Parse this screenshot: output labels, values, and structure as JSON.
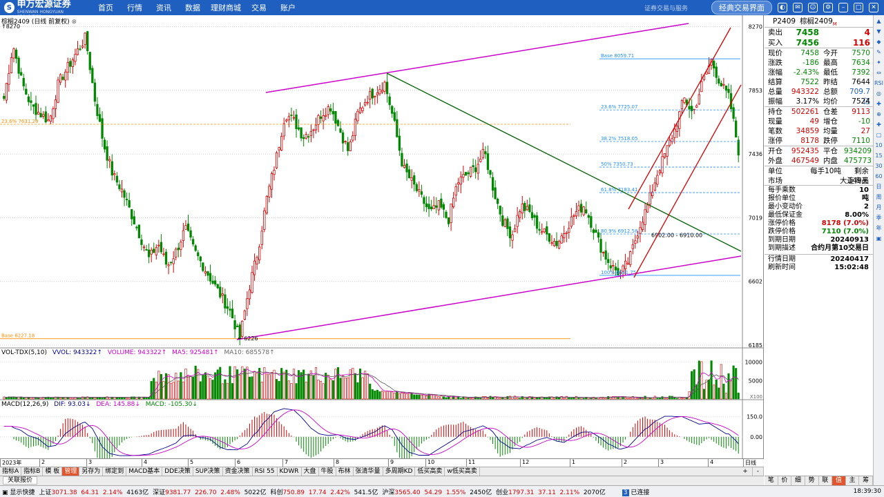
{
  "app": {
    "logo_name": "申万宏源证券",
    "logo_sub": "SHENWAN HONGYUAN SECURITIES",
    "menu": [
      "首页",
      "行情",
      "资讯",
      "数据",
      "理财商城",
      "交易",
      "账户"
    ],
    "slogan": "证券交易与服务",
    "classic_button": "经典交易界面"
  },
  "chart": {
    "symbol_title": "棕榈2409 (日线 前复权)",
    "top_label": "↑8270",
    "low_label": "← 6226",
    "fib_labels": {
      "base_top": "Base 8059.71",
      "f236": "23.6% 7725.07",
      "f382": "38.2% 7518.05",
      "f50": "50% 7350.73",
      "f618": "61.8% 7183.41",
      "f809": "80.9% 6912.58",
      "f100": "100% 6641.75",
      "left_f236": "23.6% 7631.29",
      "base_bottom": "Base 6227.18",
      "range_note": "6902.00 - 6910.00"
    },
    "vol_title": [
      "VOL-TDX(5,10)",
      "VVOL: 943322↑",
      "VOLUME: 943322↑",
      "MA5: 925481↑",
      "MA10: 685578↑"
    ],
    "macd_title": [
      "MACD(12,26,9)",
      "DIF: 93.03↓",
      "DEA: 145.88↓",
      "MACD: -105.30↓"
    ],
    "vol_axis": [
      "10000",
      "5000",
      "X100"
    ],
    "macd_axis": [
      "150.0",
      "0.00"
    ],
    "x_labels": [
      "2023年",
      "2",
      "3",
      "4",
      "5",
      "6",
      "7",
      "8",
      "9",
      "10",
      "11",
      "12",
      "1",
      "2",
      "3",
      "4"
    ],
    "period_label": "日线",
    "colors": {
      "up": "#d40000",
      "down": "#008800",
      "channel_magenta": "#cc00cc",
      "trend_green": "#006400",
      "channel_red": "#d40000",
      "fib_blue": "#1e90ff",
      "fib_orange": "#ff8c00"
    }
  },
  "chart_data": {
    "type": "candlestick",
    "symbol": "棕榈2409",
    "period": "日线",
    "yaxis_labels": [
      8270,
      7853,
      7436,
      7019,
      6602,
      6185
    ],
    "ylim": [
      6185,
      8300
    ],
    "price_range_low": 6226,
    "price_range_high": 8270,
    "last_close": 7458,
    "fib_levels": [
      8059.71,
      7725.07,
      7518.05,
      7350.73,
      7183.41,
      6912.58,
      6641.75
    ],
    "volume_ylim": [
      0,
      12000
    ],
    "macd_ylim": [
      -150,
      220
    ],
    "close_path": [
      7800,
      8150,
      7900,
      7750,
      7700,
      7650,
      7900,
      8000,
      8100,
      8200,
      7800,
      7500,
      7300,
      7200,
      7050,
      6900,
      6750,
      6850,
      6700,
      6800,
      6950,
      6800,
      6700,
      6600,
      6500,
      6400,
      6226,
      6550,
      6800,
      7150,
      7400,
      7700,
      7650,
      7550,
      7600,
      7700,
      7750,
      7600,
      7450,
      7700,
      7800,
      7850,
      7900,
      7650,
      7350,
      7250,
      7150,
      7050,
      7100,
      7000,
      7250,
      7300,
      7350,
      7450,
      7200,
      7000,
      6900,
      7100,
      7050,
      6950,
      6900,
      6850,
      6950,
      7050,
      7100,
      6950,
      6800,
      6700,
      6650,
      6750,
      6950,
      7100,
      7300,
      7450,
      7600,
      7800,
      7700,
      7900,
      8050,
      7900,
      7800,
      7458
    ]
  },
  "panel": {
    "code": "P2409",
    "name": "棕榈2409",
    "mark": "M",
    "sell": {
      "label": "卖出",
      "price": "7458",
      "vol": "4"
    },
    "buy": {
      "label": "买入",
      "price": "7456",
      "vol": "116"
    },
    "rows1": [
      {
        "l1": "现价",
        "v1": "7458",
        "c1": "grn",
        "l2": "今开",
        "v2": "7570",
        "c2": "grn"
      },
      {
        "l1": "涨跌",
        "v1": "-186",
        "c1": "grn",
        "l2": "最高",
        "v2": "7634",
        "c2": "grn"
      },
      {
        "l1": "涨幅",
        "v1": "-2.43%",
        "c1": "grn",
        "l2": "最低",
        "v2": "7392",
        "c2": "grn"
      },
      {
        "l1": "结算",
        "v1": "7522",
        "c1": "grn",
        "l2": "昨结",
        "v2": "7644",
        "c2": ""
      },
      {
        "l1": "总量",
        "v1": "943322",
        "c1": "red",
        "l2": "总额",
        "v2": "709.7亿",
        "c2": "blu"
      },
      {
        "l1": "振幅",
        "v1": "3.17%",
        "c1": "",
        "l2": "均价",
        "v2": "7524",
        "c2": ""
      }
    ],
    "rows2": [
      {
        "l1": "持仓",
        "v1": "502261",
        "c1": "red",
        "l2": "仓差",
        "v2": "9113",
        "c2": "red"
      },
      {
        "l1": "现量",
        "v1": "49",
        "c1": "red",
        "l2": "增仓",
        "v2": "-10",
        "c2": "grn"
      },
      {
        "l1": "笔数",
        "v1": "34859",
        "c1": "red",
        "l2": "均量",
        "v2": "27",
        "c2": "red"
      },
      {
        "l1": "涨停",
        "v1": "8178",
        "c1": "red",
        "l2": "跌停",
        "v2": "7110",
        "c2": "grn"
      }
    ],
    "rows3": [
      {
        "l1": "开仓",
        "v1": "952435",
        "c1": "red",
        "l2": "平仓",
        "v2": "934209",
        "c2": "grn"
      },
      {
        "l1": "外盘",
        "v1": "467549",
        "c1": "red",
        "l2": "内盘",
        "v2": "475773",
        "c2": "grn"
      }
    ],
    "unit_row": {
      "l1": "单位",
      "v1": "每手10吨",
      "l2": "剩余149天"
    },
    "market_row": {
      "l1": "市场",
      "v1": "大连商品"
    },
    "specs": [
      {
        "k": "每手乘数",
        "v": "10",
        "c": ""
      },
      {
        "k": "报价单位",
        "v": "吨",
        "c": ""
      },
      {
        "k": "最小变动价",
        "v": "2",
        "c": ""
      },
      {
        "k": "最低保证金",
        "v": "8.00%",
        "c": ""
      },
      {
        "k": "涨停价格",
        "v": "8178 (7.0%)",
        "c": "red"
      },
      {
        "k": "跌停价格",
        "v": "7110 (7.0%)",
        "c": "grn"
      },
      {
        "k": "到期日期",
        "v": "20240913",
        "c": ""
      },
      {
        "k": "到期描述",
        "v": "合约月第10交易日",
        "c": ""
      }
    ],
    "dates": [
      {
        "k": "行情日期",
        "v": "20240417"
      },
      {
        "k": "刷新时间",
        "v": "15:02:48"
      }
    ]
  },
  "tabs": [
    "指标A",
    "指标B",
    "模 板",
    "管理",
    "另存为",
    "绑定到",
    "MACD基本",
    "DDE决策",
    "SUP决策",
    "资金决策",
    "RSI 55",
    "KDWR",
    "大盘",
    "牛股",
    "布林",
    "张清华量",
    "多周期KD",
    "低买高卖",
    "w低买高卖"
  ],
  "tabs_right": [
    "+",
    "-"
  ],
  "quote_tab": "关联报价",
  "bottom_tabs": [
    "笔",
    "价",
    "细",
    "势",
    "联",
    "值",
    "主",
    "筹"
  ],
  "status": {
    "toggle": "显示快捷",
    "idx": [
      {
        "name": "上证",
        "v": "3071.38",
        "chg": "64.31",
        "pct": "2.14%",
        "amt": "4163亿"
      },
      {
        "name": "深证",
        "v": "9381.77",
        "chg": "226.70",
        "pct": "2.48%",
        "amt": "5022亿"
      },
      {
        "name": "科创",
        "v": "750.89",
        "chg": "17.74",
        "pct": "2.42%",
        "amt": "541.5亿"
      },
      {
        "name": "沪深",
        "v": "3565.40",
        "chg": "54.29",
        "pct": "1.55%",
        "amt": "2450亿"
      },
      {
        "name": "创业",
        "v": "1797.31",
        "chg": "37.11",
        "pct": "2.11%",
        "amt": "2070亿"
      }
    ],
    "conn": "已连接",
    "conn_num": "3",
    "time": "18:39:30"
  },
  "side_tools": [
    "▲",
    "▼",
    "◆",
    "✎",
    "✦",
    "⇔",
    "RSI",
    "◎",
    "✚",
    "⊕",
    "✚",
    "▢",
    "10",
    "15",
    "30",
    "60",
    "日",
    "周",
    "月",
    "季",
    "年",
    "▣"
  ]
}
